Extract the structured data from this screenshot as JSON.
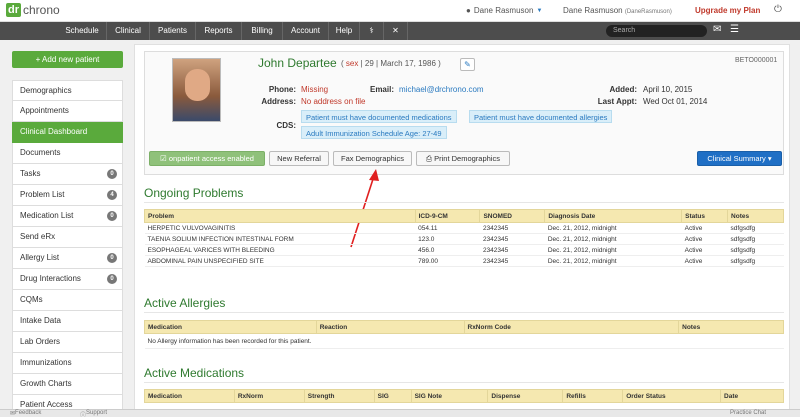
{
  "logo": {
    "badge": "dr",
    "text": "chrono"
  },
  "top": {
    "user1": "Dane Rasmuson",
    "user2_name": "Dane Rasmuson",
    "user2_handle": "(DaneRasmuson)",
    "upgrade": "Upgrade my Plan"
  },
  "nav": {
    "items": [
      "Schedule",
      "Clinical",
      "Patients",
      "Reports",
      "Billing",
      "Account",
      "Help"
    ],
    "search_placeholder": "Search"
  },
  "sidebar": {
    "add_button": "+ Add new patient",
    "items": [
      {
        "label": "Demographics",
        "badge": null
      },
      {
        "label": "Appointments",
        "badge": null
      },
      {
        "label": "Clinical Dashboard",
        "badge": null
      },
      {
        "label": "Documents",
        "badge": null
      },
      {
        "label": "Tasks",
        "badge": "0"
      },
      {
        "label": "Problem List",
        "badge": "4"
      },
      {
        "label": "Medication List",
        "badge": "0"
      },
      {
        "label": "Send eRx",
        "badge": null
      },
      {
        "label": "Allergy List",
        "badge": "0"
      },
      {
        "label": "Drug Interactions",
        "badge": "0"
      },
      {
        "label": "CQMs",
        "badge": null
      },
      {
        "label": "Intake Data",
        "badge": null
      },
      {
        "label": "Lab Orders",
        "badge": null
      },
      {
        "label": "Immunizations",
        "badge": null
      },
      {
        "label": "Growth Charts",
        "badge": null
      },
      {
        "label": "Patient Access",
        "badge": null
      }
    ]
  },
  "patient": {
    "name": "John Departee",
    "sex": "sex",
    "age": "29",
    "dob": "March 17, 1986",
    "id": "BETO000001",
    "phone_label": "Phone:",
    "phone": "Missing",
    "address_label": "Address:",
    "address": "No address on file",
    "email_label": "Email:",
    "email": "michael@drchrono.com",
    "added_label": "Added:",
    "added": "April 10, 2015",
    "last_appt_label": "Last Appt:",
    "last_appt": "Wed Oct 01, 2014",
    "cds_label": "CDS:",
    "cds": [
      "Patient must have documented medications",
      "Patient must have documented allergies",
      "Adult Immunization Schedule Age: 27-49"
    ]
  },
  "actions": {
    "onpatient": "onpatient access enabled",
    "new_referral": "New Referral",
    "fax": "Fax Demographics",
    "print": "Print Demographics",
    "clinical_summary": "Clinical Summary ▾"
  },
  "problems": {
    "title": "Ongoing Problems",
    "headers": [
      "Problem",
      "ICD-9-CM",
      "SNOMED",
      "Diagnosis Date",
      "Status",
      "Notes"
    ],
    "rows": [
      [
        "HERPETIC VULVOVAGINITIS",
        "054.11",
        "2342345",
        "Dec. 21, 2012, midnight",
        "Active",
        "sdfgsdfg"
      ],
      [
        "TAENIA SOLIUM INFECTION INTESTINAL FORM",
        "123.0",
        "2342345",
        "Dec. 21, 2012, midnight",
        "Active",
        "sdfgsdfg"
      ],
      [
        "ESOPHAGEAL VARICES WITH BLEEDING",
        "456.0",
        "2342345",
        "Dec. 21, 2012, midnight",
        "Active",
        "sdfgsdfg"
      ],
      [
        "ABDOMINAL PAIN UNSPECIFIED SITE",
        "789.00",
        "2342345",
        "Dec. 21, 2012, midnight",
        "Active",
        "sdfgsdfg"
      ]
    ]
  },
  "allergies": {
    "title": "Active Allergies",
    "headers": [
      "Medication",
      "Reaction",
      "RxNorm Code",
      "Notes"
    ],
    "empty": "No Allergy information has been recorded for this patient."
  },
  "medications": {
    "title": "Active Medications",
    "headers": [
      "Medication",
      "RxNorm",
      "Strength",
      "SIG",
      "SIG Note",
      "Dispense",
      "Refills",
      "Order Status",
      "Date"
    ]
  },
  "footer": {
    "feedback": "Feedback",
    "support": "Support",
    "chat": "Practice Chat"
  },
  "colors": {
    "brand_green": "#5aaa3c",
    "nav_bg": "#4d4d4d",
    "table_header": "#f5e8b0",
    "link_blue": "#2a7ac0",
    "alert_red": "#c0392b"
  }
}
